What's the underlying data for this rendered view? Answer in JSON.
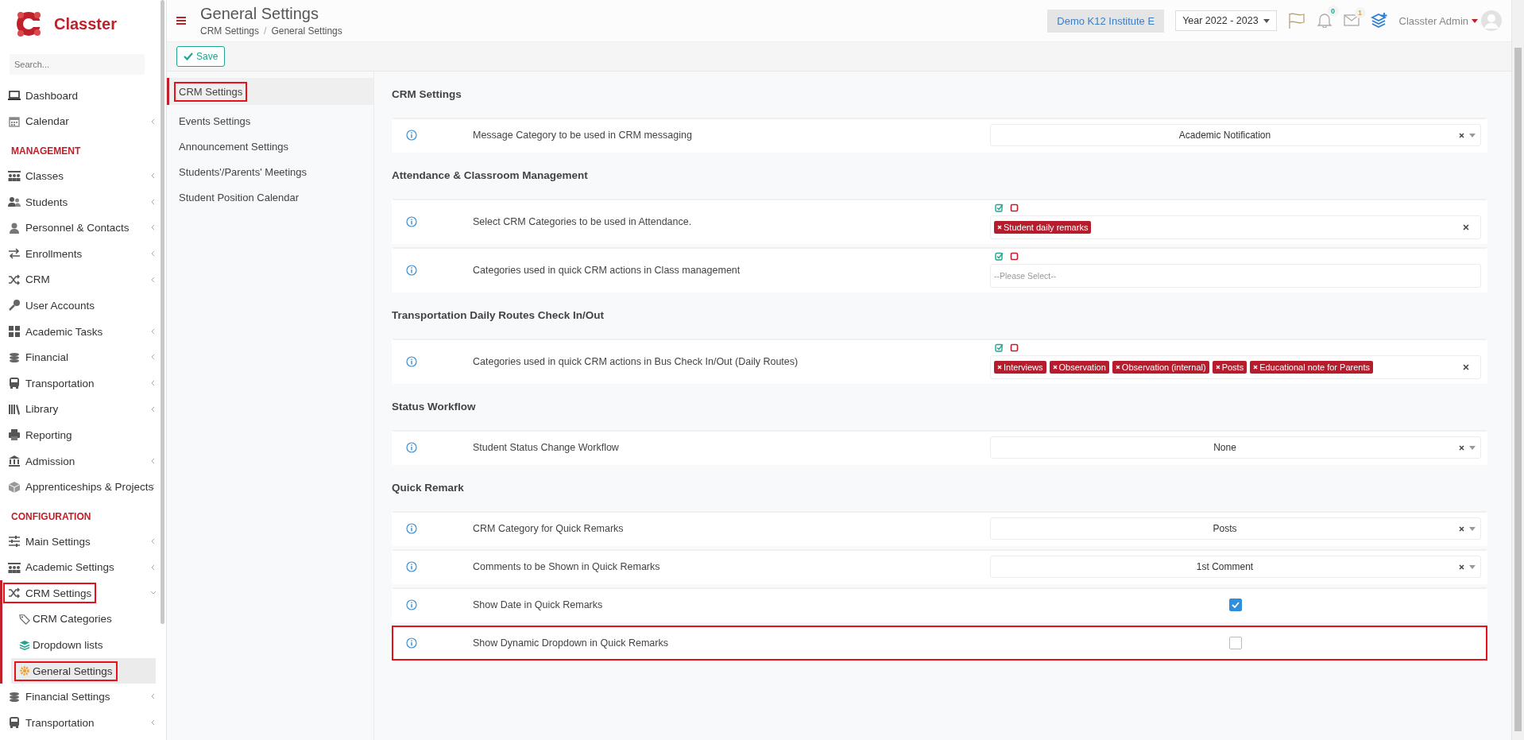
{
  "brand": {
    "name": "Classter"
  },
  "sidebar": {
    "search": {
      "placeholder": "Search..."
    },
    "items": [
      {
        "kind": "item",
        "label": "Dashboard",
        "has_submenu": false,
        "selected": false,
        "highlighted": false
      },
      {
        "kind": "item",
        "label": "Calendar",
        "has_submenu": true,
        "expanded": false,
        "selected": false,
        "highlighted": false
      },
      {
        "kind": "heading",
        "label": "MANAGEMENT"
      },
      {
        "kind": "item",
        "label": "Classes",
        "has_submenu": true,
        "expanded": false,
        "selected": false,
        "highlighted": false
      },
      {
        "kind": "item",
        "label": "Students",
        "has_submenu": true,
        "expanded": false,
        "selected": false,
        "highlighted": false
      },
      {
        "kind": "item",
        "label": "Personnel & Contacts",
        "has_submenu": true,
        "expanded": false,
        "selected": false,
        "highlighted": false
      },
      {
        "kind": "item",
        "label": "Enrollments",
        "has_submenu": true,
        "expanded": false,
        "selected": false,
        "highlighted": false
      },
      {
        "kind": "item",
        "label": "CRM",
        "has_submenu": true,
        "expanded": false,
        "selected": false,
        "highlighted": false
      },
      {
        "kind": "item",
        "label": "User Accounts",
        "has_submenu": false,
        "selected": false,
        "highlighted": false
      },
      {
        "kind": "item",
        "label": "Academic Tasks",
        "has_submenu": true,
        "expanded": false,
        "selected": false,
        "highlighted": false
      },
      {
        "kind": "item",
        "label": "Financial",
        "has_submenu": true,
        "expanded": false,
        "selected": false,
        "highlighted": false
      },
      {
        "kind": "item",
        "label": "Transportation",
        "has_submenu": true,
        "expanded": false,
        "selected": false,
        "highlighted": false
      },
      {
        "kind": "item",
        "label": "Library",
        "has_submenu": true,
        "expanded": false,
        "selected": false,
        "highlighted": false
      },
      {
        "kind": "item",
        "label": "Reporting",
        "has_submenu": false,
        "selected": false,
        "highlighted": false
      },
      {
        "kind": "item",
        "label": "Admission",
        "has_submenu": true,
        "expanded": false,
        "selected": false,
        "highlighted": false
      },
      {
        "kind": "item",
        "label": "Apprenticeships & Projects",
        "has_submenu": true,
        "expanded": false,
        "selected": false,
        "highlighted": false
      },
      {
        "kind": "heading",
        "label": "CONFIGURATION"
      },
      {
        "kind": "item",
        "label": "Main Settings",
        "has_submenu": true,
        "expanded": false,
        "selected": false,
        "highlighted": false
      },
      {
        "kind": "item",
        "label": "Academic Settings",
        "has_submenu": true,
        "expanded": false,
        "selected": false,
        "highlighted": false
      },
      {
        "kind": "item",
        "label": "CRM Settings",
        "has_submenu": true,
        "expanded": true,
        "selected": false,
        "highlighted": true
      },
      {
        "kind": "subitem",
        "label": "CRM Categories",
        "selected": false,
        "highlighted": false
      },
      {
        "kind": "subitem",
        "label": "Dropdown lists",
        "selected": false,
        "highlighted": false
      },
      {
        "kind": "subitem",
        "label": "General Settings",
        "selected": true,
        "highlighted": true
      },
      {
        "kind": "item",
        "label": "Financial Settings",
        "has_submenu": true,
        "expanded": false,
        "selected": false,
        "highlighted": false
      },
      {
        "kind": "item",
        "label": "Transportation",
        "has_submenu": true,
        "expanded": false,
        "selected": false,
        "highlighted": false
      }
    ]
  },
  "header": {
    "title": "General Settings",
    "breadcrumb": {
      "items": [
        "CRM Settings",
        "General Settings"
      ],
      "separator": "/"
    },
    "institute": "Demo K12 Institute E",
    "year": "Year 2022 - 2023",
    "notifications": {
      "count": "0"
    },
    "messages": {
      "count": "1"
    },
    "user": "Classter Admin"
  },
  "toolbar": {
    "save": "Save"
  },
  "subnav": {
    "items": [
      {
        "label": "CRM Settings",
        "selected": true,
        "highlighted": true
      },
      {
        "label": "Events Settings",
        "selected": false,
        "highlighted": false
      },
      {
        "label": "Announcement Settings",
        "selected": false,
        "highlighted": false
      },
      {
        "label": "Students'/Parents' Meetings",
        "selected": false,
        "highlighted": false
      },
      {
        "label": "Student Position Calendar",
        "selected": false,
        "highlighted": false
      }
    ]
  },
  "sections": [
    {
      "title": "CRM Settings",
      "rows": [
        {
          "label": "Message Category to be used in CRM messaging",
          "highlighted": false,
          "control": {
            "kind": "select",
            "value": "Academic Notification"
          }
        }
      ]
    },
    {
      "title": "Attendance & Classroom Management",
      "rows": [
        {
          "label": "Select CRM Categories to be used in Attendance.",
          "highlighted": false,
          "control": {
            "kind": "multiselect",
            "tags": [
              "Student daily remarks"
            ],
            "clearable": true
          }
        },
        {
          "label": "Categories used in quick CRM actions in Class management",
          "highlighted": false,
          "control": {
            "kind": "multiselect",
            "placeholder": "--Please Select--",
            "clearable": false
          }
        }
      ]
    },
    {
      "title": "Transportation Daily Routes Check In/Out",
      "rows": [
        {
          "label": "Categories used in quick CRM actions in Bus Check In/Out (Daily Routes)",
          "highlighted": false,
          "control": {
            "kind": "multiselect",
            "tags": [
              "Interviews",
              "Observation",
              "Observation (internal)",
              "Posts",
              "Educational note for Parents"
            ],
            "clearable": true
          }
        }
      ]
    },
    {
      "title": "Status Workflow",
      "rows": [
        {
          "label": "Student Status Change Workflow",
          "highlighted": false,
          "control": {
            "kind": "select",
            "value": "None"
          }
        }
      ]
    },
    {
      "title": "Quick Remark",
      "rows": [
        {
          "label": "CRM Category for Quick Remarks",
          "highlighted": false,
          "control": {
            "kind": "select",
            "value": "Posts"
          }
        },
        {
          "label": "Comments to be Shown in Quick Remarks",
          "highlighted": false,
          "control": {
            "kind": "select",
            "value": "1st Comment"
          }
        },
        {
          "label": "Show Date in Quick Remarks",
          "highlighted": false,
          "control": {
            "kind": "checkbox",
            "checked": true
          }
        },
        {
          "label": "Show Dynamic Dropdown in Quick Remarks",
          "highlighted": true,
          "control": {
            "kind": "checkbox",
            "checked": false
          }
        }
      ]
    }
  ]
}
